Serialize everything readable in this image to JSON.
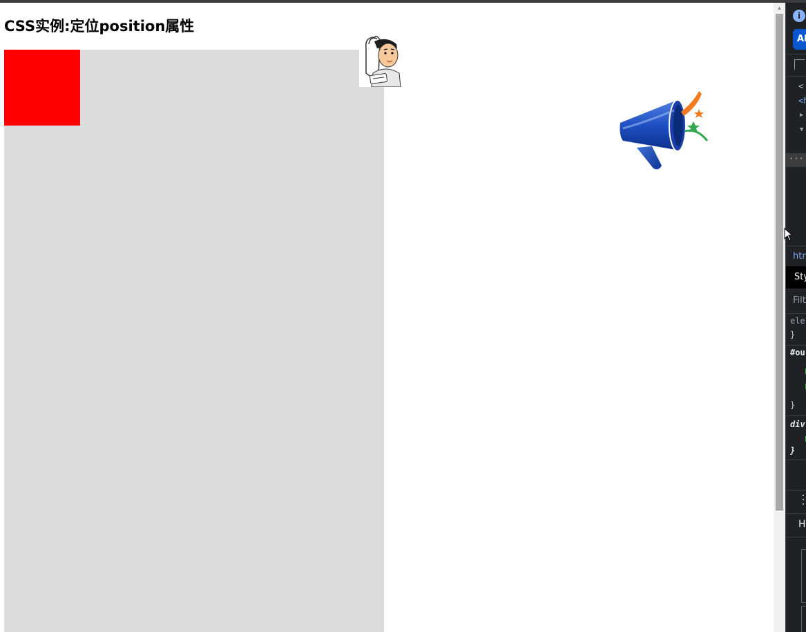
{
  "page": {
    "title": "CSS实例:定位position属性"
  },
  "colors": {
    "outer_box": "#dcdcdc",
    "inner_box": "#ff0000",
    "devtools_bg": "#202124",
    "scroll_thumb": "#a8a8a8"
  },
  "icons": {
    "cartoon": "cartoon-character-image",
    "megaphone": "megaphone-image",
    "info": "info-icon",
    "inspect": "inspect-element-icon",
    "more": "kebab-menu-icon"
  },
  "devtools": {
    "info_glyph": "i",
    "ai_badge": "AI",
    "dom_lines": [
      "<",
      "<h",
      "▶",
      "▼"
    ],
    "dots": "···",
    "breadcrumb": "htm",
    "styles_tab": "Sty",
    "filter_placeholder": "Filt",
    "rules": [
      {
        "selector": "ele",
        "close": "}"
      },
      {
        "selector": "#ou",
        "close": "}"
      },
      {
        "selector": "div",
        "close": "}"
      }
    ],
    "kebab": "⋮",
    "h_label": "H"
  }
}
